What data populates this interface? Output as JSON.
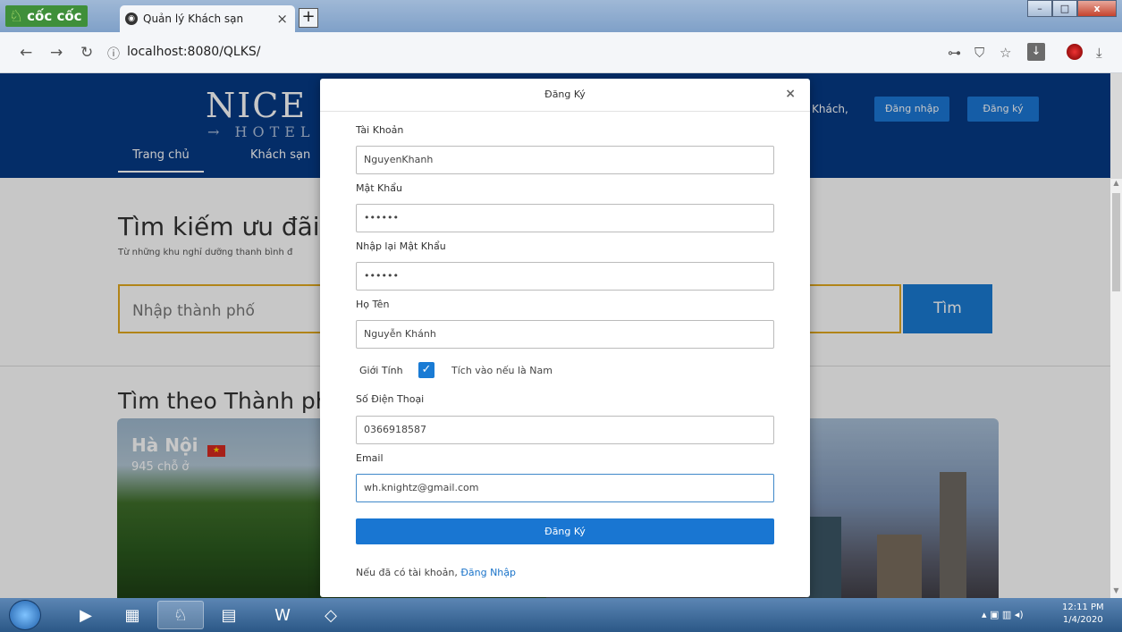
{
  "browser": {
    "brand": "cốc cốc",
    "tab_title": "Quản lý Khách sạn",
    "tab_close": "×",
    "new_tab": "+",
    "url": "localhost:8080/QLKS/",
    "icons": [
      "key-icon",
      "shield-icon",
      "star-icon",
      "download-icon",
      "avatar-icon",
      "download-arrow-icon"
    ]
  },
  "site": {
    "logo": "NICE I",
    "logo_sub": "→ HOTEL (",
    "greeting": "Khách,",
    "login_button": "Đăng nhập",
    "register_button": "Đăng ký",
    "menu": [
      "Trang chủ",
      "Khách sạn"
    ],
    "hero_title": "Tìm kiếm ưu đãi k",
    "hero_subtitle": "Từ những khu nghỉ dưỡng thanh bình đ",
    "search_placeholder": "Nhập thành phố",
    "search_button": "Tìm",
    "city_section_title": "Tìm theo Thành ph",
    "city_card": {
      "name": "Hà Nội",
      "count": "945 chỗ ở"
    }
  },
  "modal": {
    "title": "Đăng Ký",
    "close": "×",
    "fields": {
      "username_label": "Tài Khoản",
      "username_value": "NguyenKhanh",
      "password_label": "Mật Khẩu",
      "password_value": "••••••",
      "confirm_label": "Nhập lại Mật Khẩu",
      "confirm_value": "••••••",
      "fullname_label": "Họ Tên",
      "fullname_value": "Nguyễn Khánh",
      "gender_label": "Giới Tính",
      "gender_checked": true,
      "gender_hint": "Tích vào nếu là Nam",
      "phone_label": "Số Điện Thoại",
      "phone_value": "0366918587",
      "email_label": "Email",
      "email_value": "wh.knightz@gmail.com"
    },
    "submit": "Đăng Ký",
    "footer_text": "Nếu đã có tài khoản,",
    "footer_link": "Đăng Nhập"
  },
  "taskbar": {
    "time": "12:11 PM",
    "date": "1/4/2020"
  },
  "colors": {
    "header_bg": "#063a86",
    "primary": "#1976d2",
    "search_border": "#e3a91f"
  }
}
